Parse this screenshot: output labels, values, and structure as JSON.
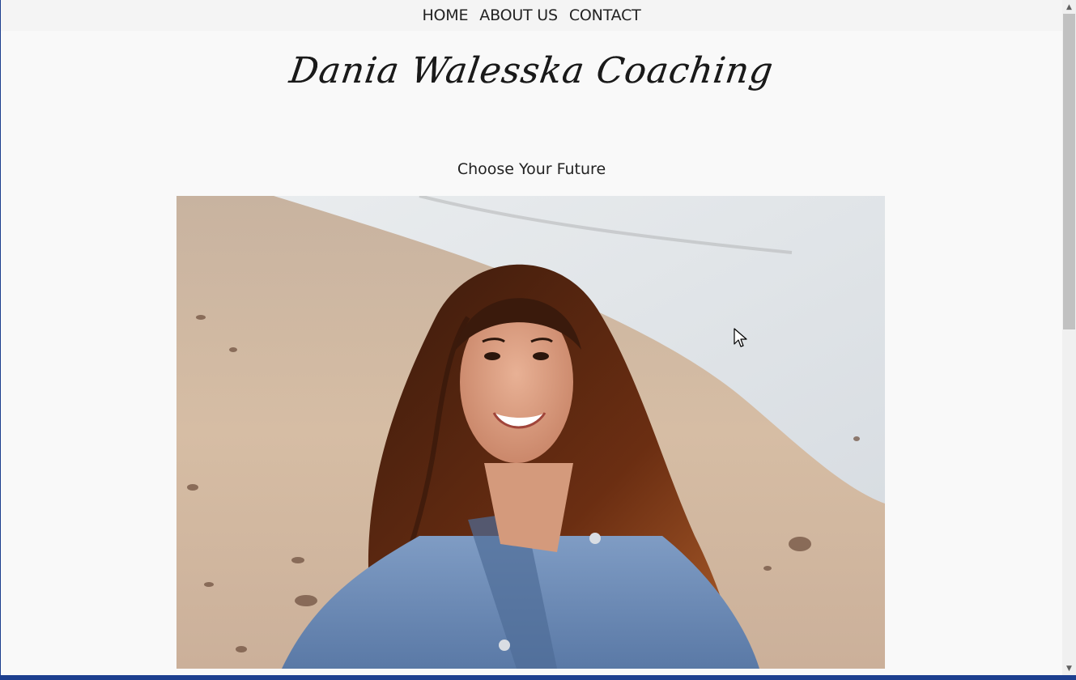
{
  "nav": {
    "items": [
      "HOME",
      "ABOUT US",
      "CONTACT"
    ]
  },
  "brand": {
    "logo_text": "Dania Walesska Coaching"
  },
  "hero": {
    "tagline": "Choose Your Future"
  },
  "colors": {
    "page_bg": "#f9f9f9",
    "nav_bg": "#f4f4f4",
    "text": "#222222",
    "sand": "#d3b79c",
    "water": "#dde2e6",
    "denim": "#6a8bb8",
    "hair": "#5a2a12"
  },
  "icons": {
    "scroll_up": "chevron-up-icon",
    "scroll_down": "chevron-down-icon",
    "cursor": "mouse-pointer-icon"
  }
}
